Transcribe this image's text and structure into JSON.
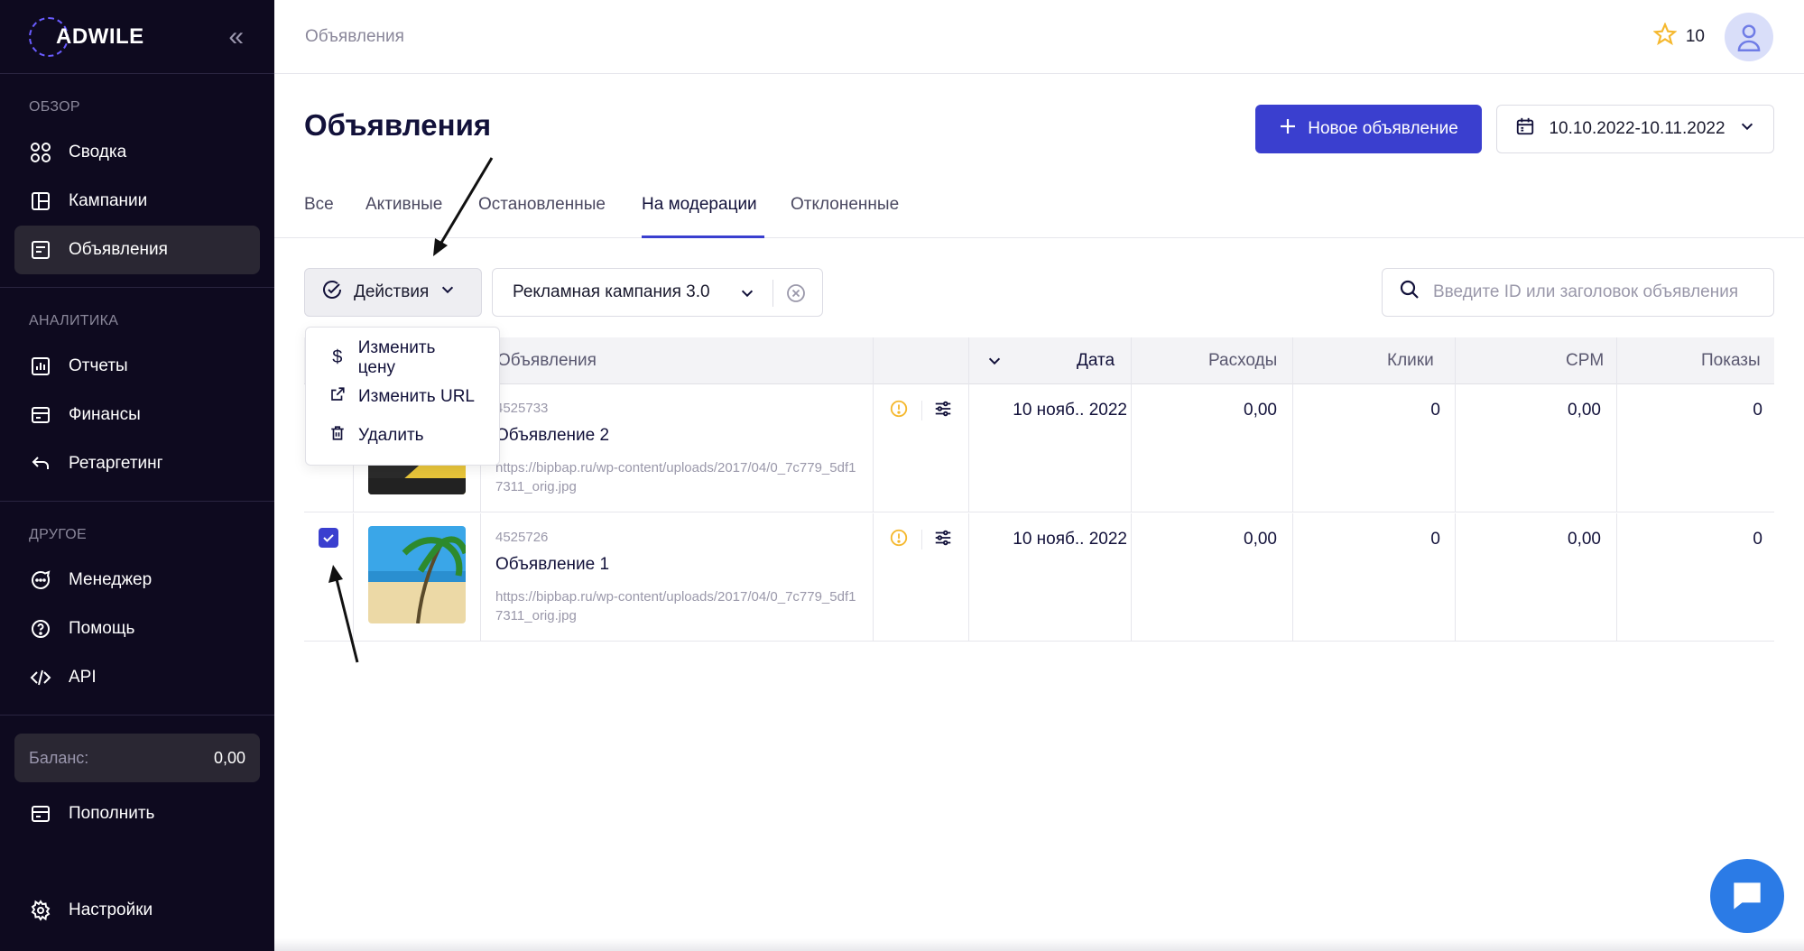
{
  "sidebar": {
    "logo": "ADWILE",
    "sections": [
      {
        "title": "ОБЗОР",
        "items": [
          {
            "label": "Сводка"
          },
          {
            "label": "Кампании"
          },
          {
            "label": "Объявления"
          }
        ]
      },
      {
        "title": "АНАЛИТИКА",
        "items": [
          {
            "label": "Отчеты"
          },
          {
            "label": "Финансы"
          },
          {
            "label": "Ретаргетинг"
          }
        ]
      },
      {
        "title": "ДРУГОЕ",
        "items": [
          {
            "label": "Менеджер"
          },
          {
            "label": "Помощь"
          },
          {
            "label": "API"
          }
        ]
      }
    ],
    "balance_label": "Баланс:",
    "balance_value": "0,00",
    "topup": "Пополнить",
    "settings": "Настройки"
  },
  "topbar": {
    "breadcrumb": "Объявления",
    "stars": "10"
  },
  "header": {
    "title": "Объявления",
    "new_button": "Новое объявление",
    "date_range": "10.10.2022-10.11.2022"
  },
  "tabs": [
    "Все",
    "Активные",
    "Остановленные",
    "На модерации",
    "Отклоненные"
  ],
  "filters": {
    "actions": "Действия",
    "campaign": "Рекламная кампания 3.0",
    "search_placeholder": "Введите ID или заголовок объявления"
  },
  "dropdown": {
    "items": [
      "Изменить цену",
      "Изменить URL",
      "Удалить"
    ]
  },
  "table": {
    "headers": {
      "ads": "Объявления",
      "date": "Дата",
      "spend": "Расходы",
      "clicks": "Клики",
      "cpm": "CPM",
      "views": "Показы"
    },
    "rows": [
      {
        "id": "4525733",
        "title": "Объявление 2",
        "url": "https://bipbap.ru/wp-content/uploads/2017/04/0_7c779_5df17311_orig.jpg",
        "date": "10 нояб.. 2022",
        "spend": "0,00",
        "clicks": "0",
        "cpm": "0,00",
        "views": "0"
      },
      {
        "id": "4525726",
        "title": "Объявление 1",
        "url": "https://bipbap.ru/wp-content/uploads/2017/04/0_7c779_5df17311_orig.jpg",
        "date": "10 нояб.. 2022",
        "spend": "0,00",
        "clicks": "0",
        "cpm": "0,00",
        "views": "0"
      }
    ]
  },
  "colors": {
    "accent": "#3a3fcf",
    "sidebar": "#0e0a1f",
    "warning": "#f5b82e"
  }
}
